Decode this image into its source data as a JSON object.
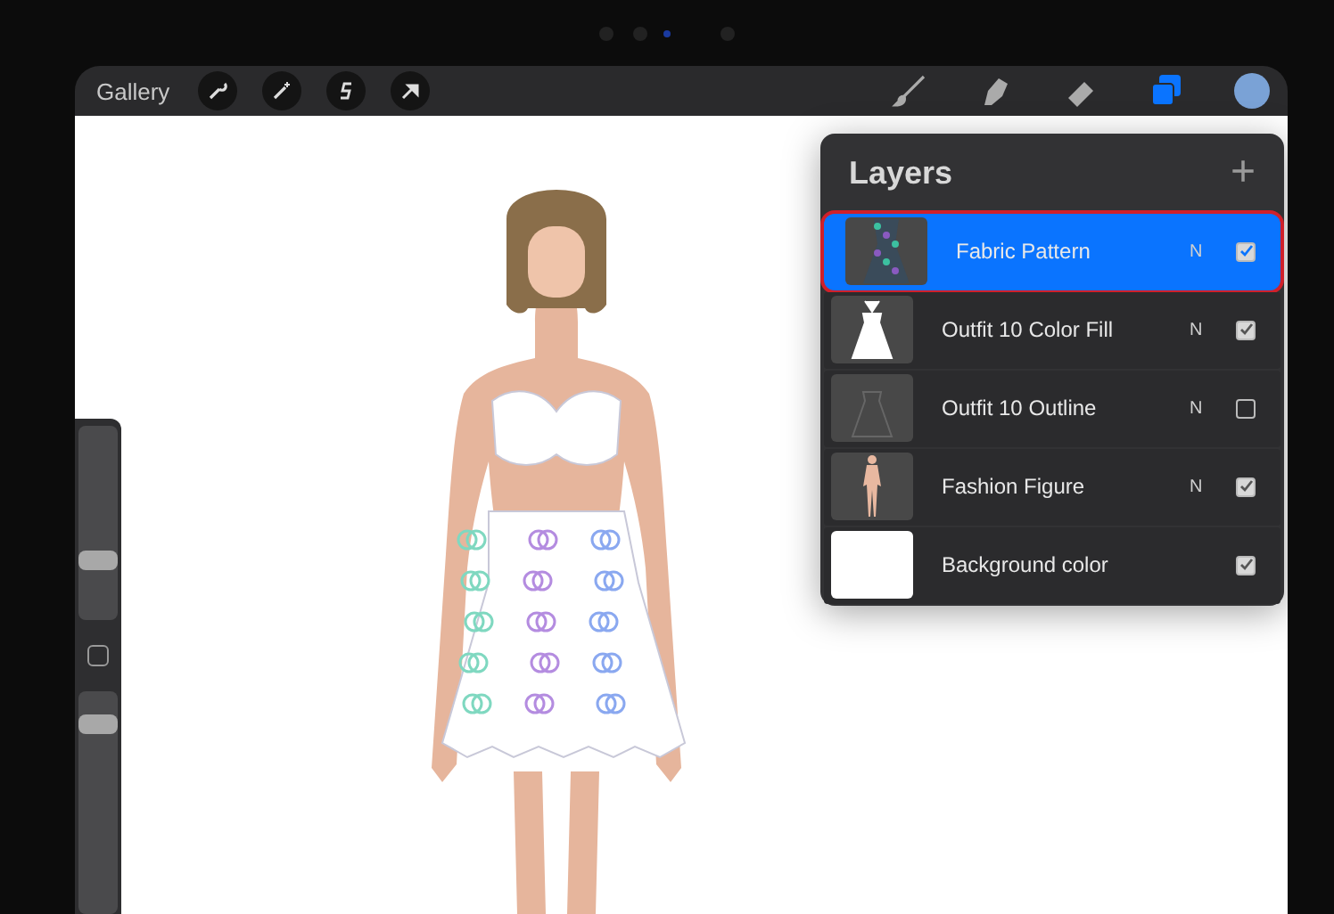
{
  "toolbar": {
    "gallery": "Gallery"
  },
  "sidebar": {
    "sliders": [
      {
        "kind": "size",
        "level": 0.27
      },
      {
        "kind": "opacity",
        "level": 0.85
      }
    ]
  },
  "layers_panel": {
    "title": "Layers",
    "add": "+",
    "layers": [
      {
        "name": "Fabric Pattern",
        "blend": "N",
        "visible": true,
        "selected": true,
        "highlighted": true,
        "kind": "pattern"
      },
      {
        "name": "Outfit 10 Color Fill",
        "blend": "N",
        "visible": true,
        "selected": false,
        "highlighted": false,
        "kind": "dress"
      },
      {
        "name": "Outfit 10 Outline",
        "blend": "N",
        "visible": false,
        "selected": false,
        "highlighted": false,
        "kind": "outline"
      },
      {
        "name": "Fashion Figure",
        "blend": "N",
        "visible": true,
        "selected": false,
        "highlighted": false,
        "kind": "figure"
      },
      {
        "name": "Background color",
        "visible": true,
        "selected": false,
        "highlighted": false,
        "kind": "white"
      }
    ]
  }
}
